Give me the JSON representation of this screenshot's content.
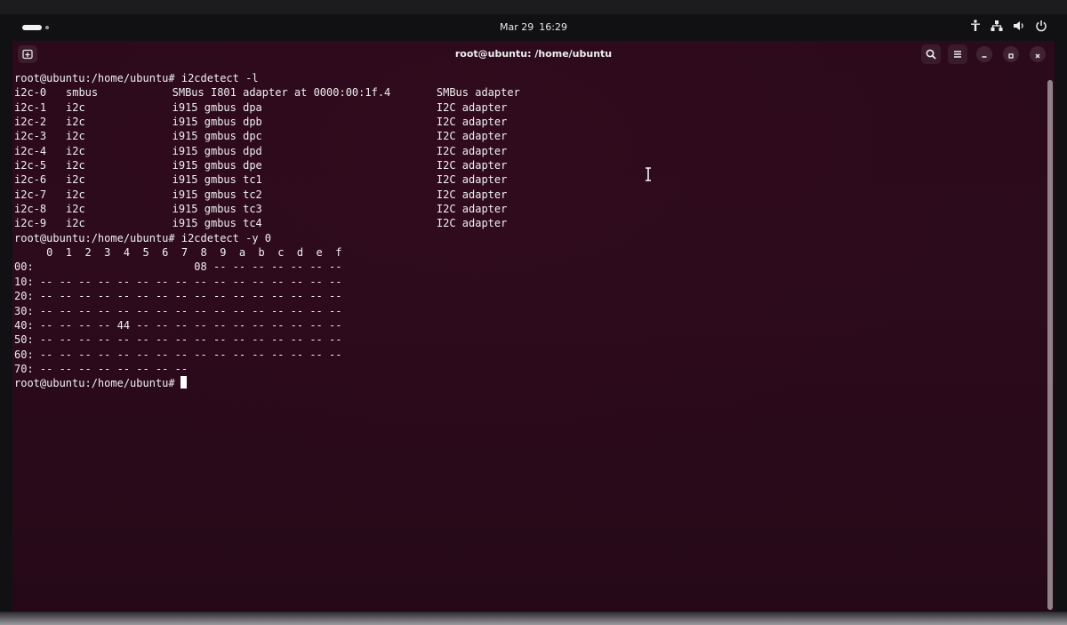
{
  "topbar": {
    "date": "Mar 29",
    "time": "16:29",
    "icons": [
      "activities-indicator",
      "accessibility-icon",
      "network-icon",
      "volume-icon",
      "power-icon"
    ]
  },
  "window": {
    "title": "root@ubuntu: /home/ubuntu",
    "icons": [
      "new-tab-icon",
      "search-icon",
      "menu-icon",
      "minimize-icon",
      "maximize-icon",
      "close-icon"
    ]
  },
  "terminal": {
    "prompt": "root@ubuntu:/home/ubuntu#",
    "commands": [
      "i2cdetect -l",
      "i2cdetect -y 0"
    ],
    "adapters": [
      {
        "bus": "i2c-0",
        "type": "smbus",
        "name": "SMBus I801 adapter at 0000:00:1f.4",
        "desc": "SMBus adapter"
      },
      {
        "bus": "i2c-1",
        "type": "i2c",
        "name": "i915 gmbus dpa",
        "desc": "I2C adapter"
      },
      {
        "bus": "i2c-2",
        "type": "i2c",
        "name": "i915 gmbus dpb",
        "desc": "I2C adapter"
      },
      {
        "bus": "i2c-3",
        "type": "i2c",
        "name": "i915 gmbus dpc",
        "desc": "I2C adapter"
      },
      {
        "bus": "i2c-4",
        "type": "i2c",
        "name": "i915 gmbus dpd",
        "desc": "I2C adapter"
      },
      {
        "bus": "i2c-5",
        "type": "i2c",
        "name": "i915 gmbus dpe",
        "desc": "I2C adapter"
      },
      {
        "bus": "i2c-6",
        "type": "i2c",
        "name": "i915 gmbus tc1",
        "desc": "I2C adapter"
      },
      {
        "bus": "i2c-7",
        "type": "i2c",
        "name": "i915 gmbus tc2",
        "desc": "I2C adapter"
      },
      {
        "bus": "i2c-8",
        "type": "i2c",
        "name": "i915 gmbus tc3",
        "desc": "I2C adapter"
      },
      {
        "bus": "i2c-9",
        "type": "i2c",
        "name": "i915 gmbus tc4",
        "desc": "I2C adapter"
      }
    ],
    "grid_header": "     0  1  2  3  4  5  6  7  8  9  a  b  c  d  e  f",
    "grid_rows": [
      "00:                         08 -- -- -- -- -- -- --",
      "10: -- -- -- -- -- -- -- -- -- -- -- -- -- -- -- --",
      "20: -- -- -- -- -- -- -- -- -- -- -- -- -- -- -- --",
      "30: -- -- -- -- -- -- -- -- -- -- -- -- -- -- -- --",
      "40: -- -- -- -- 44 -- -- -- -- -- -- -- -- -- -- --",
      "50: -- -- -- -- -- -- -- -- -- -- -- -- -- -- -- --",
      "60: -- -- -- -- -- -- -- -- -- -- -- -- -- -- -- --",
      "70: -- -- -- -- -- -- -- --"
    ]
  }
}
